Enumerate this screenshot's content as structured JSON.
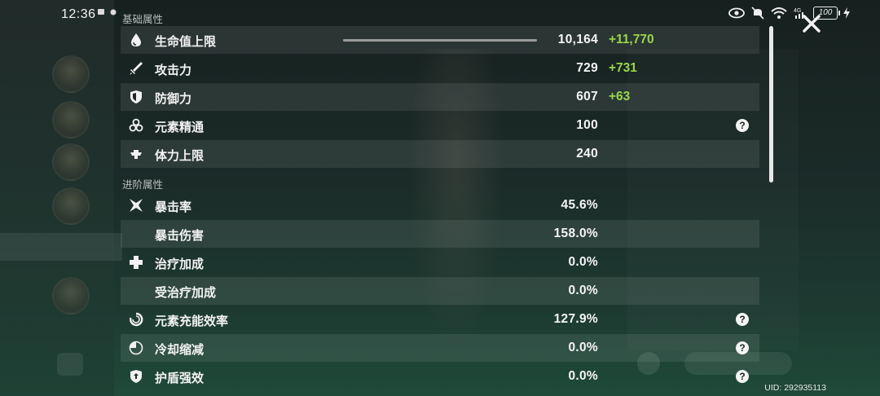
{
  "status_bar": {
    "time": "12:36",
    "battery": "100",
    "icons": [
      "eye-icon",
      "mute-icon",
      "wifi-icon",
      "signal-4g-icon",
      "battery-icon",
      "charging-icon"
    ]
  },
  "sections": {
    "basic": "基础属性",
    "advanced": "进阶属性"
  },
  "basic_stats": [
    {
      "icon": "drop-icon",
      "name": "生命值上限",
      "value": "10,164",
      "bonus": "+11,770",
      "help": false,
      "hp_bar_fraction": 1.0
    },
    {
      "icon": "sword-icon",
      "name": "攻击力",
      "value": "729",
      "bonus": "+731",
      "help": false
    },
    {
      "icon": "shield-icon",
      "name": "防御力",
      "value": "607",
      "bonus": "+63",
      "help": false
    },
    {
      "icon": "elemental-mastery-icon",
      "name": "元素精通",
      "value": "100",
      "bonus": "",
      "help": true
    },
    {
      "icon": "stamina-icon",
      "name": "体力上限",
      "value": "240",
      "bonus": "",
      "help": false
    }
  ],
  "advanced_stats": [
    {
      "icon": "crit-rate-icon",
      "name": "暴击率",
      "value": "45.6%",
      "help": false
    },
    {
      "icon": "",
      "name": "暴击伤害",
      "value": "158.0%",
      "help": false
    },
    {
      "icon": "healing-cross-icon",
      "name": "治疗加成",
      "value": "0.0%",
      "help": false
    },
    {
      "icon": "",
      "name": "受治疗加成",
      "value": "0.0%",
      "help": false
    },
    {
      "icon": "energy-recharge-icon",
      "name": "元素充能效率",
      "value": "127.9%",
      "help": true
    },
    {
      "icon": "cooldown-icon",
      "name": "冷却缩减",
      "value": "0.0%",
      "help": true
    },
    {
      "icon": "shield-strength-icon",
      "name": "护盾强效",
      "value": "0.0%",
      "help": true
    }
  ],
  "help_label": "?",
  "uid": "UID: 292935113",
  "colors": {
    "bonus": "#9ad54a",
    "text": "#f2f2f2"
  }
}
